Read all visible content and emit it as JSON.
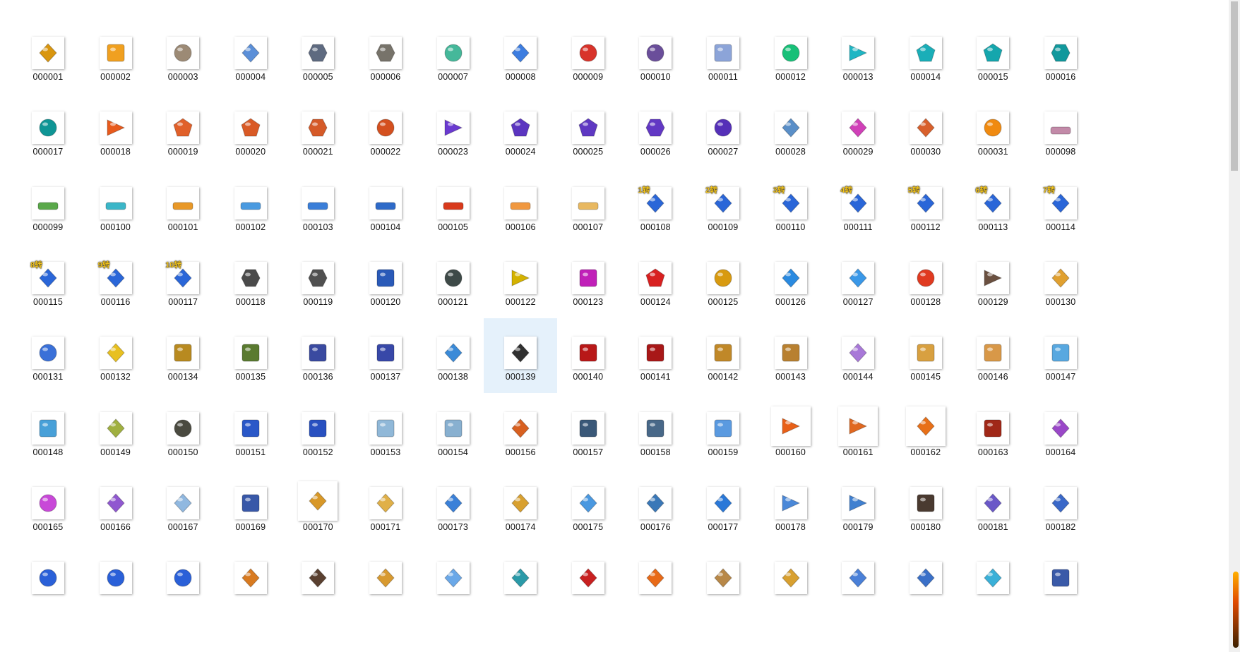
{
  "grid": {
    "selected_index": 71,
    "items": [
      {
        "name": "000001",
        "icon": "amber-crystal-icon",
        "color": "#d9960f",
        "shape": "diamond"
      },
      {
        "name": "000002",
        "icon": "scroll-icon",
        "color": "#f0a020",
        "shape": "square"
      },
      {
        "name": "000003",
        "icon": "beast-head-icon",
        "color": "#9c8a75",
        "shape": "circle"
      },
      {
        "name": "000004",
        "icon": "ice-wing-icon",
        "color": "#5b8fd8",
        "shape": "diamond"
      },
      {
        "name": "000005",
        "icon": "demon-mask-icon",
        "color": "#5e6a80",
        "shape": "hexagon"
      },
      {
        "name": "000006",
        "icon": "stone-shield-icon",
        "color": "#77736a",
        "shape": "hexagon"
      },
      {
        "name": "000007",
        "icon": "spiral-icon",
        "color": "#45b89a",
        "shape": "circle"
      },
      {
        "name": "000008",
        "icon": "blue-crystal-icon",
        "color": "#3d7de0",
        "shape": "diamond"
      },
      {
        "name": "000009",
        "icon": "red-orb-icon",
        "color": "#d8332a",
        "shape": "circle"
      },
      {
        "name": "000010",
        "icon": "striped-egg-icon",
        "color": "#6a4e9a",
        "shape": "circle"
      },
      {
        "name": "000011",
        "icon": "gift-box-icon",
        "color": "#8ca4d8",
        "shape": "square"
      },
      {
        "name": "000012",
        "icon": "green-orb-icon",
        "color": "#18c078",
        "shape": "circle"
      },
      {
        "name": "000013",
        "icon": "cyan-triangle-icon",
        "color": "#1fb6c4",
        "shape": "triangle"
      },
      {
        "name": "000014",
        "icon": "cyan-gem-icon",
        "color": "#1aaeb8",
        "shape": "pentagon"
      },
      {
        "name": "000015",
        "icon": "cyan-gem-icon",
        "color": "#15a6ad",
        "shape": "pentagon"
      },
      {
        "name": "000016",
        "icon": "cyan-gem-icon",
        "color": "#11989c",
        "shape": "hexagon"
      },
      {
        "name": "000017",
        "icon": "teal-orb-icon",
        "color": "#0f9595",
        "shape": "circle"
      },
      {
        "name": "000018",
        "icon": "orange-triangle-icon",
        "color": "#e85a1c",
        "shape": "triangle"
      },
      {
        "name": "000019",
        "icon": "orange-gem-icon",
        "color": "#e0602a",
        "shape": "pentagon"
      },
      {
        "name": "000020",
        "icon": "orange-gem-icon",
        "color": "#d95a26",
        "shape": "pentagon"
      },
      {
        "name": "000021",
        "icon": "orange-gem-icon",
        "color": "#d55a28",
        "shape": "hexagon"
      },
      {
        "name": "000022",
        "icon": "orange-orb-icon",
        "color": "#d4501f",
        "shape": "circle"
      },
      {
        "name": "000023",
        "icon": "purple-triangle-icon",
        "color": "#6a3ad0",
        "shape": "triangle"
      },
      {
        "name": "000024",
        "icon": "purple-gem-icon",
        "color": "#5b35c0",
        "shape": "pentagon"
      },
      {
        "name": "000025",
        "icon": "purple-gem-icon",
        "color": "#5e38c2",
        "shape": "pentagon"
      },
      {
        "name": "000026",
        "icon": "purple-gem-icon",
        "color": "#6238c4",
        "shape": "hexagon"
      },
      {
        "name": "000027",
        "icon": "purple-orb-icon",
        "color": "#5530b8",
        "shape": "circle"
      },
      {
        "name": "000028",
        "icon": "blue-amulet-icon",
        "color": "#5a8fc8",
        "shape": "diamond"
      },
      {
        "name": "000029",
        "icon": "pink-amulet-icon",
        "color": "#d040b8",
        "shape": "diamond"
      },
      {
        "name": "000030",
        "icon": "orange-amulet-icon",
        "color": "#d8602c",
        "shape": "diamond"
      },
      {
        "name": "000031",
        "icon": "fire-orb-icon",
        "color": "#f08a10",
        "shape": "circle"
      },
      {
        "name": "000098",
        "icon": "aura-effect-icon",
        "color": "#c28aa8",
        "shape": "bar"
      },
      {
        "name": "000099",
        "icon": "aura-effect-icon",
        "color": "#5aa84a",
        "shape": "bar"
      },
      {
        "name": "000100",
        "icon": "aura-effect-icon",
        "color": "#3bb6c8",
        "shape": "bar"
      },
      {
        "name": "000101",
        "icon": "aura-effect-icon",
        "color": "#e89828",
        "shape": "bar"
      },
      {
        "name": "000102",
        "icon": "aura-effect-icon",
        "color": "#4a9ae0",
        "shape": "bar"
      },
      {
        "name": "000103",
        "icon": "aura-effect-icon",
        "color": "#3a7ed8",
        "shape": "bar"
      },
      {
        "name": "000104",
        "icon": "aura-effect-icon",
        "color": "#2e6ac8",
        "shape": "bar"
      },
      {
        "name": "000105",
        "icon": "aura-effect-icon",
        "color": "#d83a1c",
        "shape": "bar"
      },
      {
        "name": "000106",
        "icon": "aura-effect-icon",
        "color": "#f09840",
        "shape": "bar"
      },
      {
        "name": "000107",
        "icon": "aura-effect-icon",
        "color": "#e8b860",
        "shape": "bar"
      },
      {
        "name": "000108",
        "icon": "blue-crystal-icon",
        "color": "#2a66d8",
        "shape": "diamond",
        "tag": "1转"
      },
      {
        "name": "000109",
        "icon": "blue-crystal-icon",
        "color": "#2a66d8",
        "shape": "diamond",
        "tag": "2转"
      },
      {
        "name": "000110",
        "icon": "blue-crystal-icon",
        "color": "#2a66d8",
        "shape": "diamond",
        "tag": "3转"
      },
      {
        "name": "000111",
        "icon": "blue-crystal-icon",
        "color": "#2a66d8",
        "shape": "diamond",
        "tag": "4转"
      },
      {
        "name": "000112",
        "icon": "blue-crystal-icon",
        "color": "#2a66d8",
        "shape": "diamond",
        "tag": "5转"
      },
      {
        "name": "000113",
        "icon": "blue-crystal-icon",
        "color": "#2a66d8",
        "shape": "diamond",
        "tag": "6转"
      },
      {
        "name": "000114",
        "icon": "blue-crystal-icon",
        "color": "#2a66d8",
        "shape": "diamond",
        "tag": "7转"
      },
      {
        "name": "000115",
        "icon": "blue-crystal-icon",
        "color": "#2a66d8",
        "shape": "diamond",
        "tag": "8转"
      },
      {
        "name": "000116",
        "icon": "blue-crystal-icon",
        "color": "#2a66d8",
        "shape": "diamond",
        "tag": "9转"
      },
      {
        "name": "000117",
        "icon": "blue-crystal-icon",
        "color": "#2a66d8",
        "shape": "diamond",
        "tag": "10转"
      },
      {
        "name": "000118",
        "icon": "green-rock-icon",
        "color": "#4a4a4a",
        "shape": "hexagon"
      },
      {
        "name": "000119",
        "icon": "red-rock-icon",
        "color": "#505050",
        "shape": "hexagon"
      },
      {
        "name": "000120",
        "icon": "blue-book-icon",
        "color": "#2a5ab8",
        "shape": "square"
      },
      {
        "name": "000121",
        "icon": "horn-icon",
        "color": "#3e4a48",
        "shape": "circle"
      },
      {
        "name": "000122",
        "icon": "yellow-gem-icon",
        "color": "#d4b200",
        "shape": "triangle"
      },
      {
        "name": "000123",
        "icon": "magenta-gem-icon",
        "color": "#c020b8",
        "shape": "square"
      },
      {
        "name": "000124",
        "icon": "red-gem-icon",
        "color": "#d82020",
        "shape": "pentagon"
      },
      {
        "name": "000125",
        "icon": "gold-orb-icon",
        "color": "#d89a10",
        "shape": "circle"
      },
      {
        "name": "000126",
        "icon": "blue-diamond-icon",
        "color": "#2a8ae0",
        "shape": "diamond"
      },
      {
        "name": "000127",
        "icon": "ice-shard-icon",
        "color": "#3a98e8",
        "shape": "diamond"
      },
      {
        "name": "000128",
        "icon": "lucky-charm-icon",
        "color": "#e03a20",
        "shape": "circle"
      },
      {
        "name": "000129",
        "icon": "dark-wings-icon",
        "color": "#6a5040",
        "shape": "triangle"
      },
      {
        "name": "000130",
        "icon": "gold-wings-icon",
        "color": "#e0a030",
        "shape": "diamond"
      },
      {
        "name": "000131",
        "icon": "blue-flame-icon",
        "color": "#3a70d8",
        "shape": "circle"
      },
      {
        "name": "000132",
        "icon": "gold-blade-icon",
        "color": "#e8c020",
        "shape": "diamond"
      },
      {
        "name": "000134",
        "icon": "gold-emblem-icon",
        "color": "#b88a20",
        "shape": "square"
      },
      {
        "name": "000135",
        "icon": "green-emblem-icon",
        "color": "#5a7a30",
        "shape": "square"
      },
      {
        "name": "000136",
        "icon": "armor-portrait-icon",
        "color": "#3a4aa0",
        "shape": "square"
      },
      {
        "name": "000137",
        "icon": "armor-portrait-icon",
        "color": "#3848a8",
        "shape": "square"
      },
      {
        "name": "000138",
        "icon": "ice-sword-icon",
        "color": "#3a8ad8",
        "shape": "diamond"
      },
      {
        "name": "000139",
        "icon": "dark-blade-icon",
        "color": "#303030",
        "shape": "diamond"
      },
      {
        "name": "000140",
        "icon": "red-armor-icon",
        "color": "#b81818",
        "shape": "square"
      },
      {
        "name": "000141",
        "icon": "red-armor-icon",
        "color": "#a81818",
        "shape": "square"
      },
      {
        "name": "000142",
        "icon": "gold-armor-icon",
        "color": "#c08828",
        "shape": "square"
      },
      {
        "name": "000143",
        "icon": "gold-armor-icon",
        "color": "#b88030",
        "shape": "square"
      },
      {
        "name": "000144",
        "icon": "violet-blade-icon",
        "color": "#a878d8",
        "shape": "diamond"
      },
      {
        "name": "000145",
        "icon": "winged-armor-icon",
        "color": "#d8a040",
        "shape": "square"
      },
      {
        "name": "000146",
        "icon": "winged-armor-icon",
        "color": "#d89848",
        "shape": "square"
      },
      {
        "name": "000147",
        "icon": "winged-armor-icon",
        "color": "#58a8e0",
        "shape": "square"
      },
      {
        "name": "000148",
        "icon": "winged-armor-icon",
        "color": "#48a0d8",
        "shape": "square"
      },
      {
        "name": "000149",
        "icon": "jeweled-staff-icon",
        "color": "#a0b040",
        "shape": "diamond"
      },
      {
        "name": "000150",
        "icon": "scythe-icon",
        "color": "#4a4a40",
        "shape": "circle"
      },
      {
        "name": "000151",
        "icon": "blue-armor-icon",
        "color": "#2a58c8",
        "shape": "square"
      },
      {
        "name": "000152",
        "icon": "blue-armor-icon",
        "color": "#2850c0",
        "shape": "square"
      },
      {
        "name": "000153",
        "icon": "pale-armor-icon",
        "color": "#90b8d8",
        "shape": "square"
      },
      {
        "name": "000154",
        "icon": "pale-armor-icon",
        "color": "#88b0d0",
        "shape": "square"
      },
      {
        "name": "000156",
        "icon": "fire-sword-icon",
        "color": "#d86020",
        "shape": "diamond"
      },
      {
        "name": "000157",
        "icon": "silver-armor-icon",
        "color": "#3a5878",
        "shape": "square"
      },
      {
        "name": "000158",
        "icon": "silver-armor-icon",
        "color": "#486888",
        "shape": "square"
      },
      {
        "name": "000159",
        "icon": "ice-armor-icon",
        "color": "#5a9ae0",
        "shape": "square"
      },
      {
        "name": "000160",
        "icon": "phoenix-icon",
        "color": "#e86018",
        "shape": "triangle",
        "large": true
      },
      {
        "name": "000161",
        "icon": "phoenix-icon",
        "color": "#e06820",
        "shape": "triangle",
        "large": true
      },
      {
        "name": "000162",
        "icon": "fire-spirit-icon",
        "color": "#e87018",
        "shape": "diamond",
        "large": true
      },
      {
        "name": "000163",
        "icon": "red-gear-icon",
        "color": "#a02818",
        "shape": "square"
      },
      {
        "name": "000164",
        "icon": "purple-sword-icon",
        "color": "#9a48c8",
        "shape": "diamond"
      },
      {
        "name": "000165",
        "icon": "pink-scythe-icon",
        "color": "#c848d8",
        "shape": "circle"
      },
      {
        "name": "000166",
        "icon": "violet-sword-icon",
        "color": "#9058d0",
        "shape": "diamond"
      },
      {
        "name": "000167",
        "icon": "pale-blade-icon",
        "color": "#90b8e0",
        "shape": "diamond"
      },
      {
        "name": "000169",
        "icon": "blue-armor-icon",
        "color": "#3858a8",
        "shape": "square"
      },
      {
        "name": "000170",
        "icon": "gold-staff-icon",
        "color": "#d89828",
        "shape": "diamond",
        "large": true
      },
      {
        "name": "000171",
        "icon": "gold-staff-icon",
        "color": "#e0b048",
        "shape": "diamond"
      },
      {
        "name": "000173",
        "icon": "blue-wand-icon",
        "color": "#3a80d8",
        "shape": "diamond"
      },
      {
        "name": "000174",
        "icon": "gold-wand-icon",
        "color": "#d8a030",
        "shape": "diamond"
      },
      {
        "name": "000175",
        "icon": "blue-wand-icon",
        "color": "#4a98e0",
        "shape": "diamond"
      },
      {
        "name": "000176",
        "icon": "blue-dagger-icon",
        "color": "#3a78b8",
        "shape": "diamond"
      },
      {
        "name": "000177",
        "icon": "blue-blade-icon",
        "color": "#2a78d8",
        "shape": "diamond"
      },
      {
        "name": "000178",
        "icon": "blue-wings-icon",
        "color": "#4a88d8",
        "shape": "triangle"
      },
      {
        "name": "000179",
        "icon": "blue-wings-icon",
        "color": "#4080d0",
        "shape": "triangle"
      },
      {
        "name": "000180",
        "icon": "dark-armor-icon",
        "color": "#4a3a30",
        "shape": "square"
      },
      {
        "name": "000181",
        "icon": "violet-sword-icon",
        "color": "#6a58c8",
        "shape": "diamond"
      },
      {
        "name": "000182",
        "icon": "blue-feather-icon",
        "color": "#3a68c8",
        "shape": "diamond"
      },
      {
        "name": "",
        "icon": "blue-flame-icon",
        "color": "#2a60d8",
        "shape": "circle"
      },
      {
        "name": "",
        "icon": "blue-flame-icon",
        "color": "#2a60d8",
        "shape": "circle"
      },
      {
        "name": "",
        "icon": "blue-flame-icon",
        "color": "#2a60d8",
        "shape": "circle"
      },
      {
        "name": "",
        "icon": "orange-weapon-icon",
        "color": "#d87a20",
        "shape": "diamond"
      },
      {
        "name": "",
        "icon": "dark-weapon-icon",
        "color": "#5a4030",
        "shape": "diamond"
      },
      {
        "name": "",
        "icon": "gold-weapon-icon",
        "color": "#d89a30",
        "shape": "diamond"
      },
      {
        "name": "",
        "icon": "ice-weapon-icon",
        "color": "#6aa8e8",
        "shape": "diamond"
      },
      {
        "name": "",
        "icon": "teal-weapon-icon",
        "color": "#2a9aa8",
        "shape": "diamond"
      },
      {
        "name": "",
        "icon": "red-weapon-icon",
        "color": "#c82020",
        "shape": "diamond"
      },
      {
        "name": "",
        "icon": "fire-weapon-icon",
        "color": "#e86a18",
        "shape": "diamond"
      },
      {
        "name": "",
        "icon": "bronze-weapon-icon",
        "color": "#b88848",
        "shape": "diamond"
      },
      {
        "name": "",
        "icon": "gold-weapon-icon",
        "color": "#d8a030",
        "shape": "diamond"
      },
      {
        "name": "",
        "icon": "blue-weapon-icon",
        "color": "#4a80d8",
        "shape": "diamond"
      },
      {
        "name": "",
        "icon": "blue-weapon-icon",
        "color": "#3a70c8",
        "shape": "diamond"
      },
      {
        "name": "",
        "icon": "cyan-weapon-icon",
        "color": "#3ab0d8",
        "shape": "diamond"
      },
      {
        "name": "",
        "icon": "armor-portrait-icon",
        "color": "#3a5aa8",
        "shape": "square"
      }
    ]
  }
}
